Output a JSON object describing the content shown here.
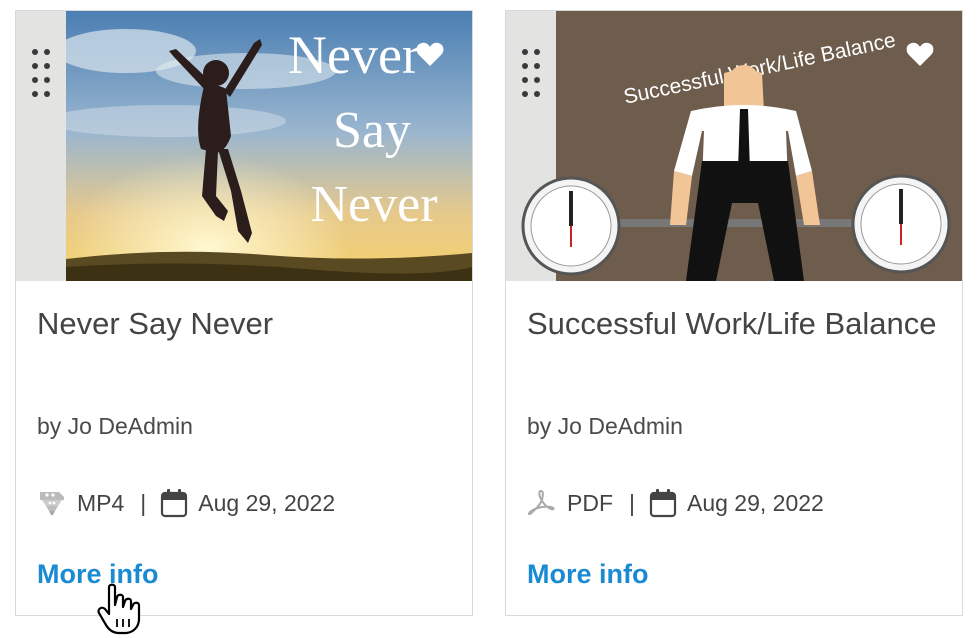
{
  "cards": [
    {
      "title": "Never Say Never",
      "author": "by Jo DeAdmin",
      "file_type": "MP4",
      "file_type_icon": "video-file-icon",
      "separator": "|",
      "date": "Aug 29, 2022",
      "more_info": "More info",
      "image_text": [
        "Never",
        "Say",
        "Never"
      ],
      "favorite_icon": "heart-icon"
    },
    {
      "title": "Successful Work/Life Balance",
      "author": "by Jo DeAdmin",
      "file_type": "PDF",
      "file_type_icon": "pdf-file-icon",
      "separator": "|",
      "date": "Aug 29, 2022",
      "more_info": "More info",
      "image_text": [
        "Successful Work/Life Balance"
      ],
      "favorite_icon": "heart-icon"
    }
  ],
  "colors": {
    "link": "#1a8bd3",
    "text": "#444444",
    "border": "#d9d9d9"
  }
}
